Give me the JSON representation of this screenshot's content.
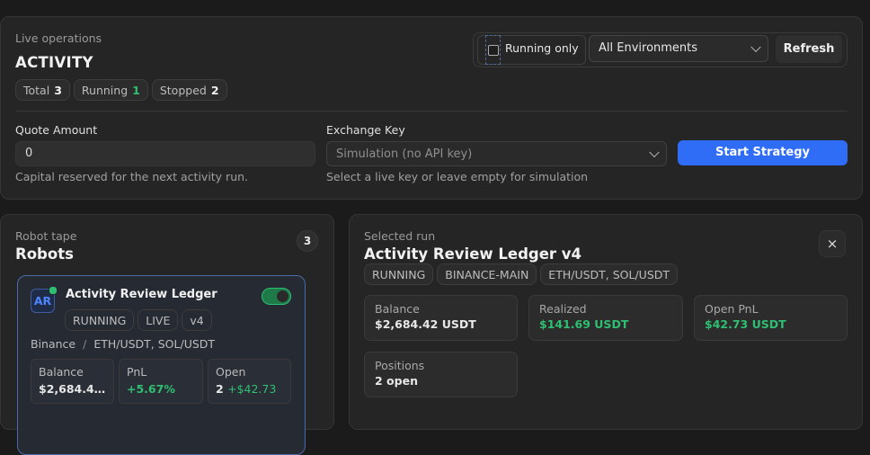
{
  "activity": {
    "eyebrow": "Live operations",
    "title": "ACTIVITY",
    "counts": [
      {
        "label": "Total",
        "value": "3"
      },
      {
        "label": "Running",
        "value": "1"
      },
      {
        "label": "Stopped",
        "value": "2"
      }
    ],
    "running_only_label": "Running only",
    "environment_selected": "All Environments",
    "refresh_label": "Refresh",
    "quote_amount_label": "Quote Amount",
    "quote_amount_value": "0",
    "quote_amount_help": "Capital reserved for the next activity run.",
    "exchange_key_label": "Exchange Key",
    "exchange_key_placeholder": "Simulation (no API key)",
    "exchange_key_help": "Select a live key or leave empty for simulation",
    "start_label": "Start Strategy"
  },
  "robots": {
    "eyebrow": "Robot tape",
    "title": "Robots",
    "count": "3",
    "card": {
      "avatar": "AR",
      "name": "Activity Review Ledger",
      "toggle_on": true,
      "tags": [
        "RUNNING",
        "LIVE",
        "v4"
      ],
      "exchange": "Binance",
      "separator": "/",
      "pairs": "ETH/USDT, SOL/USDT",
      "balance_label": "Balance",
      "balance_value": "$2,684.4…",
      "pnl_label": "PnL",
      "pnl_value": "+5.67%",
      "open_label": "Open",
      "open_count": "2",
      "open_value": "+$42.73"
    }
  },
  "selected": {
    "eyebrow": "Selected run",
    "title": "Activity Review Ledger v4",
    "close_glyph": "×",
    "tags": [
      "RUNNING",
      "BINANCE-MAIN",
      "ETH/USDT, SOL/USDT"
    ],
    "stats": [
      {
        "label": "Balance",
        "value": "$2,684.42 USDT"
      },
      {
        "label": "Realized",
        "value": "$141.69 USDT"
      },
      {
        "label": "Open PnL",
        "value": "$42.73 USDT"
      },
      {
        "label": "Positions",
        "value": "2 open"
      }
    ]
  },
  "colors": {
    "accent": "#2f6df6",
    "positive": "#2fbf71",
    "background": "#1b1b1b",
    "panel": "#252525"
  }
}
